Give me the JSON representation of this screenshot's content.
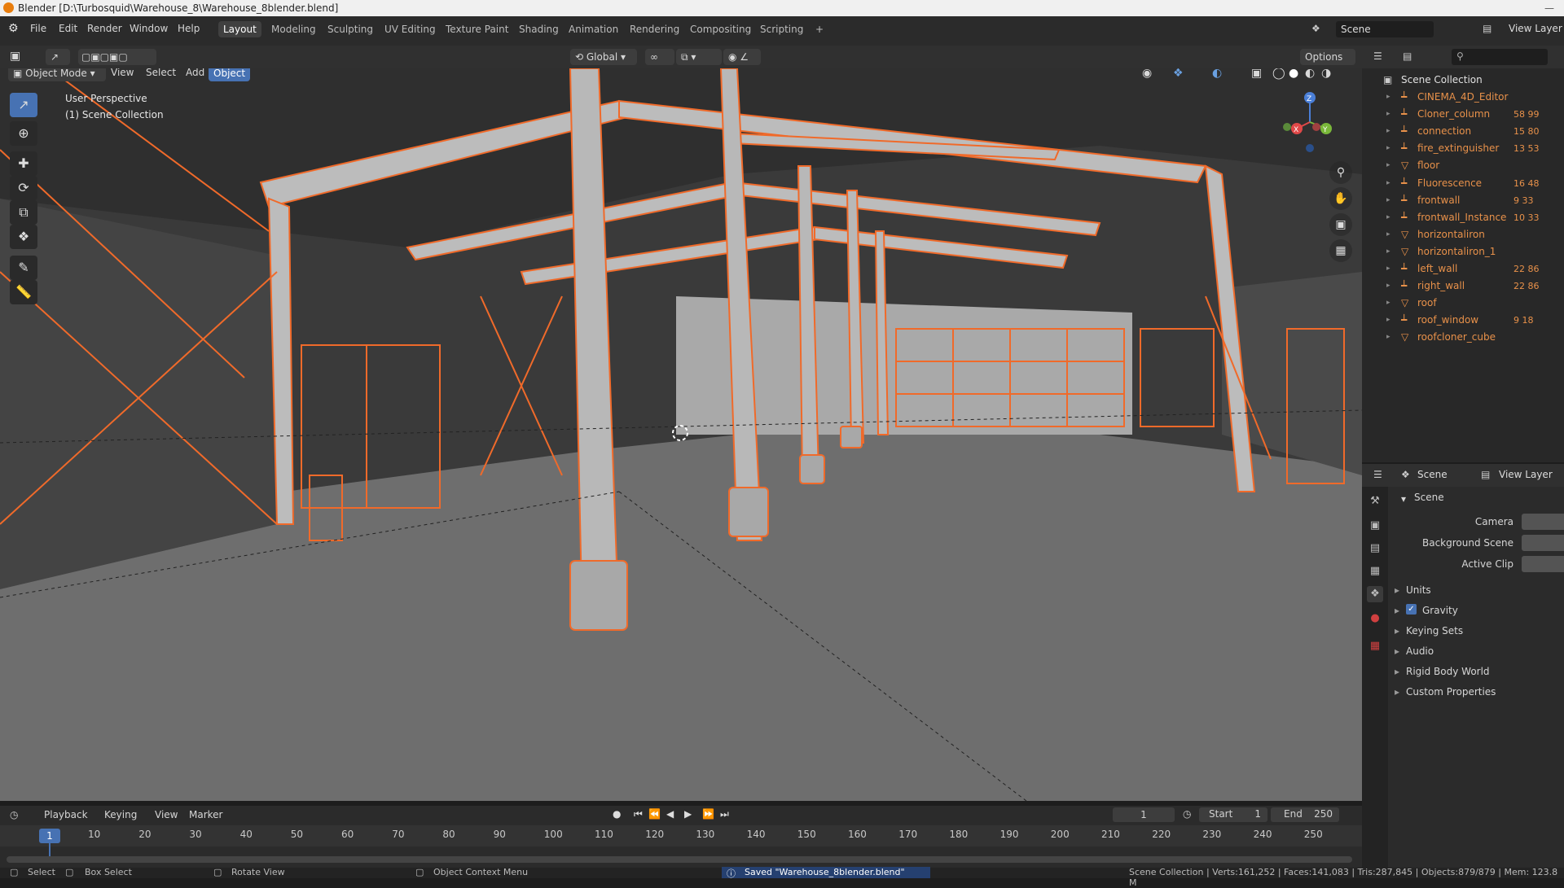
{
  "window_title": "Blender [D:\\Turbosquid\\Warehouse_8\\Warehouse_8blender.blend]",
  "menus": [
    "File",
    "Edit",
    "Render",
    "Window",
    "Help"
  ],
  "workspaces": [
    "Layout",
    "Modeling",
    "Sculpting",
    "UV Editing",
    "Texture Paint",
    "Shading",
    "Animation",
    "Rendering",
    "Compositing",
    "Scripting",
    "+"
  ],
  "active_workspace": "Layout",
  "scene_field": "Scene",
  "view_layer_field": "View Layer",
  "viewport_header": {
    "mode": "Object Mode",
    "menu_view": "View",
    "menu_select": "Select",
    "menu_add": "Add",
    "menu_object": "Object",
    "transform_orientation": "Global",
    "options": "Options"
  },
  "viewport_overlay": {
    "perspective": "User Perspective",
    "collection": "(1) Scene Collection"
  },
  "gizmo": {
    "x": "X",
    "y": "Y",
    "z": "Z"
  },
  "colors": {
    "wire": "#f06a2a",
    "steel": "#bcbcbc",
    "floor": "#6c6c6c",
    "accent": "#4772b3"
  },
  "outliner": {
    "root": "Scene Collection",
    "items": [
      {
        "name": "CINEMA_4D_Editor",
        "icon": "armature-icon",
        "extra": ""
      },
      {
        "name": "Cloner_column",
        "icon": "armature-icon",
        "extra": "58 99"
      },
      {
        "name": "connection",
        "icon": "armature-icon",
        "extra": "15 80"
      },
      {
        "name": "fire_extinguisher",
        "icon": "armature-icon",
        "extra": "13 53"
      },
      {
        "name": "floor",
        "icon": "mesh-icon",
        "extra": ""
      },
      {
        "name": "Fluorescence",
        "icon": "armature-icon",
        "extra": "16 48"
      },
      {
        "name": "frontwall",
        "icon": "armature-icon",
        "extra": "9 33"
      },
      {
        "name": "frontwall_Instance",
        "icon": "armature-icon",
        "extra": "10 33"
      },
      {
        "name": "horizontaliron",
        "icon": "mesh-icon",
        "extra": ""
      },
      {
        "name": "horizontaliron_1",
        "icon": "mesh-icon",
        "extra": ""
      },
      {
        "name": "left_wall",
        "icon": "armature-icon",
        "extra": "22 86"
      },
      {
        "name": "right_wall",
        "icon": "armature-icon",
        "extra": "22 86"
      },
      {
        "name": "roof",
        "icon": "mesh-icon",
        "extra": ""
      },
      {
        "name": "roof_window",
        "icon": "armature-icon",
        "extra": "9 18"
      },
      {
        "name": "roofcloner_cube",
        "icon": "mesh-icon",
        "extra": ""
      }
    ]
  },
  "properties": {
    "header_scene": "Scene",
    "header_view_layer": "View Layer",
    "panel_title": "Scene",
    "camera_label": "Camera",
    "background_label": "Background Scene",
    "active_clip_label": "Active Clip",
    "sections": [
      "Units",
      "Gravity",
      "Keying Sets",
      "Audio",
      "Rigid Body World",
      "Custom Properties"
    ],
    "gravity_checked": true
  },
  "timeline": {
    "menus": [
      "Playback",
      "Keying",
      "View",
      "Marker"
    ],
    "current_frame": "1",
    "start_label": "Start",
    "start": "1",
    "end_label": "End",
    "end": "250",
    "ticks": [
      "10",
      "20",
      "30",
      "40",
      "50",
      "60",
      "70",
      "80",
      "90",
      "100",
      "110",
      "120",
      "130",
      "140",
      "150",
      "160",
      "170",
      "180",
      "190",
      "200",
      "210",
      "220",
      "230",
      "240",
      "250"
    ],
    "playhead": "1"
  },
  "status": {
    "select": "Select",
    "box_select": "Box Select",
    "rotate_view": "Rotate View",
    "context_menu": "Object Context Menu",
    "saved": "Saved \"Warehouse_8blender.blend\"",
    "stats": "Scene Collection | Verts:161,252 | Faces:141,083 | Tris:287,845 | Objects:879/879 | Mem: 123.8 M"
  }
}
